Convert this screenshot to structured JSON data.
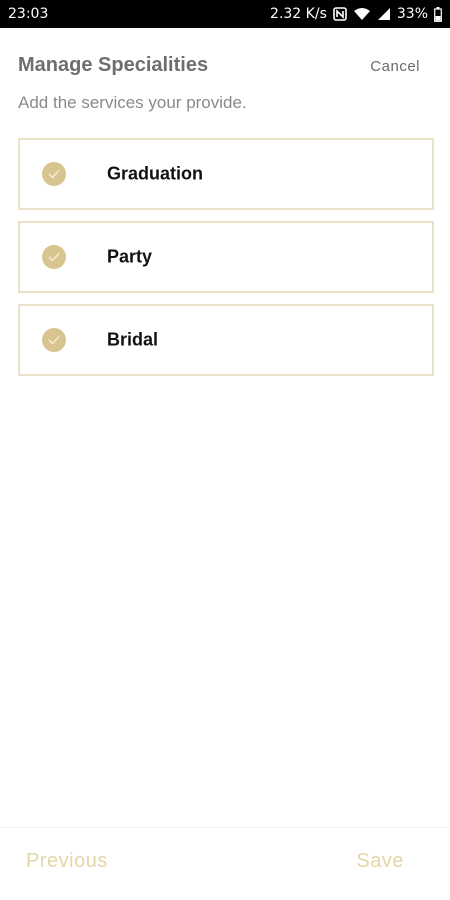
{
  "status_bar": {
    "time": "23:03",
    "speed": "2.32 K/s",
    "battery": "33%",
    "icons": [
      "nfc-icon",
      "wifi-icon",
      "signal-icon",
      "battery-icon"
    ]
  },
  "header": {
    "title": "Manage Specialities",
    "cancel_label": "Cancel",
    "subtitle": "Add the services your provide."
  },
  "specialities": [
    {
      "label": "Graduation",
      "checked": true
    },
    {
      "label": "Party",
      "checked": true
    },
    {
      "label": "Bridal",
      "checked": true
    }
  ],
  "footer": {
    "previous_label": "Previous",
    "save_label": "Save"
  },
  "colors": {
    "accent": "#d8c48e",
    "border": "#e8e3c8",
    "footer_text": "#e3d6a8"
  }
}
